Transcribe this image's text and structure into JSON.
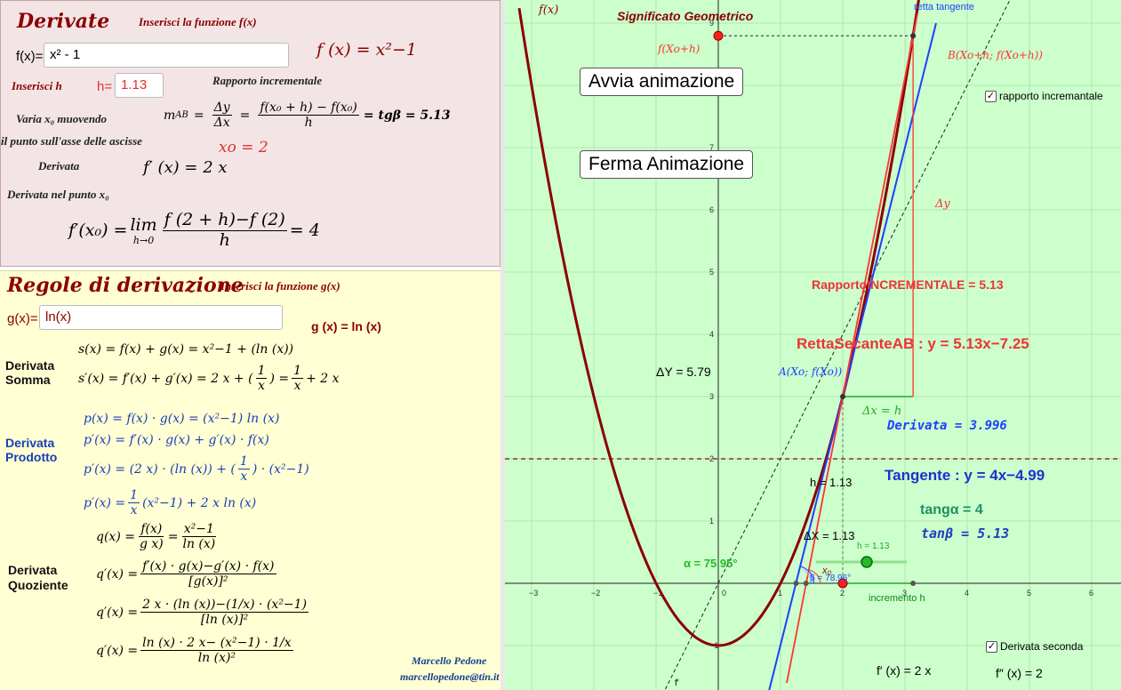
{
  "panel_top": {
    "title": "Derivate",
    "insert_f_label": "Inserisci la funzione f(x)",
    "f_input_label": "f(x)=",
    "f_input_value": "x² - 1",
    "f_display": "f (x)  =  x²−1",
    "insert_h_label": "Inserisci h",
    "h_input_label": "h=",
    "h_input_value": "1.13",
    "rapporto_label": "Rapporto incrementale",
    "varia_label": "Varia x₀  muovendo",
    "punto_label": "il  punto sull'asse delle ascisse",
    "m_ab": "m",
    "m_ab_sub": "AB",
    "delta_y": "Δy",
    "delta_x": "Δx",
    "ratio_num": "f(x₀ + h) − f(x₀)",
    "ratio_den": "h",
    "ratio_result": "= tgβ = 5.13",
    "xo_value": "xo  =  2",
    "derivata_label": "Derivata",
    "derivata_expr": "f′ (x)  =  2 x",
    "derivata_punto_label": "Derivata nel punto x₀",
    "limit_lhs": "f′(x₀) = ",
    "limit_word": "lim",
    "limit_sub": "h→0",
    "limit_num": "f (2 + h)−f (2)",
    "limit_den": "h",
    "limit_result": "= 4"
  },
  "panel_bottom": {
    "title": "Regole di derivazione",
    "insert_g_label": "Inserisci la funzione g(x)",
    "g_input_label": "g(x)=",
    "g_input_value": "ln(x)",
    "g_display": "g (x)  =  ln (x)",
    "somma_label_1": "Derivata",
    "somma_label_2": "Somma",
    "s_expr": "s(x) = f(x) + g(x) = x²−1 + (ln (x))",
    "s_prime_lhs": "s′(x) = f′(x) + g′(x) = 2 x + (",
    "s_prime_frac_num": "1",
    "s_prime_frac_den": "x",
    "s_prime_mid": ") = ",
    "s_prime_tail": " + 2 x",
    "prodotto_label_1": "Derivata",
    "prodotto_label_2": "Prodotto",
    "p_expr": "p(x) = f(x) · g(x) = (x²−1)  ln (x)",
    "p_prime_1": "p′(x) = f′(x) · g(x) + g′(x) · f(x)",
    "p_prime_2a": "p′(x) = (2 x) · (ln (x)) + (",
    "p_prime_2b": ") · (x²−1)",
    "p_prime_3a": "p′(x) = ",
    "p_prime_3b": "  (x²−1) + 2 x  ln (x)",
    "quoziente_label_1": "Derivata",
    "quoziente_label_2": "Quoziente",
    "q_lhs": "q(x) = ",
    "q_num1": "f(x)",
    "q_den1": "g x)",
    "q_num2": "x²−1",
    "q_den2": "ln (x)",
    "qp1_lhs": "q′(x) = ",
    "qp1_num": "f′(x) · g(x)−g′(x) · f(x)",
    "qp1_den": "[g(x)]²",
    "qp2_num": "2 x · (ln (x))−(1/x) · (x²−1)",
    "qp2_den": "[ln (x)]²",
    "qp3_num": "ln (x) · 2 x− (x²−1) · 1/x",
    "qp3_den": "ln (x)²",
    "author": "Marcello Pedone",
    "email": "marcellopedone@tin.it"
  },
  "graph": {
    "title": "Significato Geometrico",
    "f_label": "f(x)",
    "retta_tangente_label": "retta tangente",
    "fxoh_label": "f(Xo+h)",
    "b_label": "B(Xo+h; f(Xo+h))",
    "a_label": "A(Xo; f(Xo))",
    "dy_label": "Δy",
    "dx_label": "Δx = h",
    "rapporto_incr": "RapportoINCREMENTALE  =  5.13",
    "secante": "RettaSecanteAB :  y = 5.13x−7.25",
    "delta_Y": "ΔY  =  5.79",
    "derivata_val": "Derivata = 3.996",
    "tangente": "Tangente :  y = 4x−4.99",
    "tang_alpha": "tangα  =  4",
    "tan_beta": "tanβ  =  5.13",
    "h_val": "h  =  1.13",
    "dX_val": "ΔX  =  1.13",
    "slider_label": "h = 1.13",
    "alpha_label": "α  =  75.95°",
    "beta_label": "β = 78.96°",
    "x0_label": "x₀",
    "incremento_label": "incremento h",
    "fprime_text": "f′ (x)  =  2 x",
    "fsecond_text": "f″ (x)  =  2",
    "fprime_curve_label": "f′",
    "btn_start": "Avvia animazione",
    "btn_stop": "Ferma Animazione",
    "chk_rapporto": "rapporto incremantale",
    "chk_derivata2": "Derivata seconda",
    "chk_mark": "✓",
    "x_ticks": [
      "−3",
      "−2",
      "−1",
      "0",
      "1",
      "2",
      "3",
      "4",
      "5",
      "6"
    ],
    "y_ticks": [
      "9",
      "7",
      "6",
      "5",
      "4",
      "3",
      "2",
      "1",
      "−1"
    ],
    "colors": {
      "curve": "#8b0000",
      "secant": "#ff3333",
      "tangent": "#1f3fff",
      "green": "#22aa22",
      "bg": "#ccffcc"
    }
  }
}
